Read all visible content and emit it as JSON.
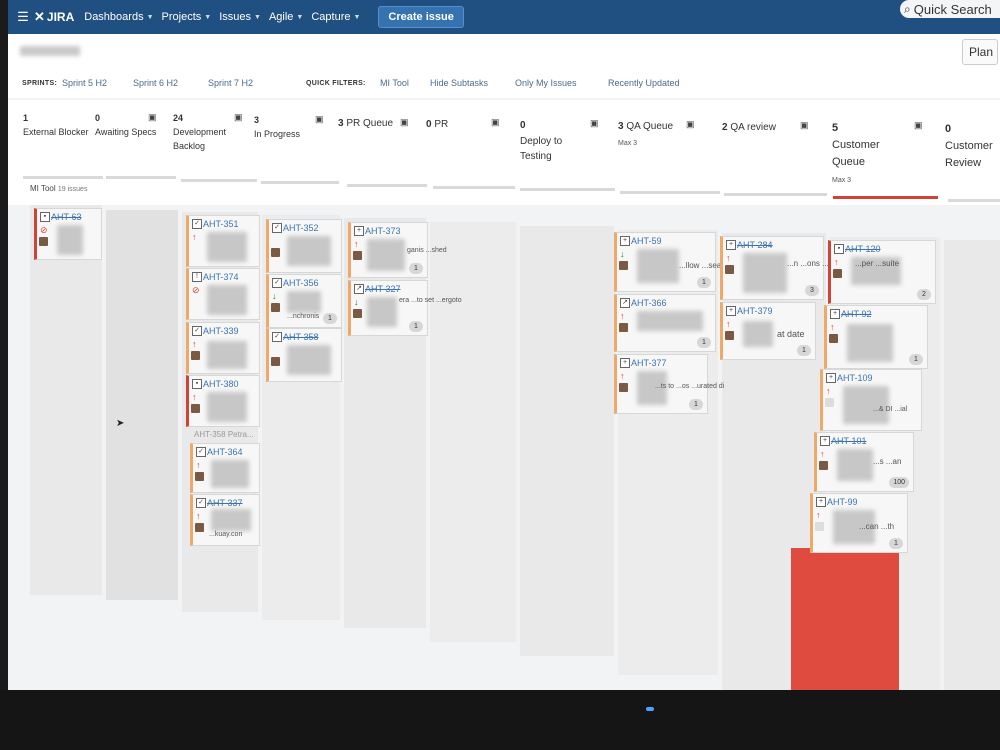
{
  "nav": {
    "menu_glyph": "☰",
    "logo_text": "JIRA",
    "items": [
      "Dashboards",
      "Projects",
      "Issues",
      "Agile",
      "Capture"
    ],
    "create_label": "Create issue",
    "search_placeholder": "Quick Search"
  },
  "subheader": {
    "plan_label": "Plan"
  },
  "filterbar": {
    "sprints_label": "SPRINTS:",
    "sprints": [
      "Sprint 5 H2",
      "Sprint 6 H2",
      "Sprint 7 H2"
    ],
    "quick_filters_label": "QUICK FILTERS:",
    "quick_filters": [
      "MI Tool",
      "Hide Subtasks",
      "Only My Issues",
      "Recently Updated"
    ]
  },
  "columns": [
    {
      "count": "1",
      "name": "External Blocker"
    },
    {
      "count": "0",
      "name": "Awaiting Specs"
    },
    {
      "count": "24",
      "name": "Development Backlog"
    },
    {
      "count": "3",
      "name": "In Progress"
    },
    {
      "count": "3",
      "name": "PR Queue"
    },
    {
      "count": "0",
      "name": "PR"
    },
    {
      "count": "0",
      "name": "Deploy to Testing"
    },
    {
      "count": "3",
      "name": "QA Queue",
      "max": "Max 3"
    },
    {
      "count": "2",
      "name": "QA review"
    },
    {
      "count": "5",
      "name": "Customer Queue",
      "max": "Max 3"
    },
    {
      "count": "0",
      "name": "Customer Review"
    }
  ],
  "swimlane": {
    "label": "MI Tool",
    "sub": "19 issues"
  },
  "cards": {
    "c1": {
      "key": "AHT-63"
    },
    "c2": {
      "key": "AHT-351"
    },
    "c3": {
      "key": "AHT-374"
    },
    "c4": {
      "key": "AHT-339"
    },
    "c5": {
      "key": "AHT-380"
    },
    "c6": {
      "key": "AHT-358",
      "text": "Petra..."
    },
    "c7": {
      "key": "AHT-364"
    },
    "c8": {
      "key": "AHT-337",
      "text": "...kuay.con"
    },
    "c9": {
      "key": "AHT-352"
    },
    "c10": {
      "key": "AHT-356",
      "text": "...nchronis",
      "badge": "1"
    },
    "c11": {
      "key": "AHT-358"
    },
    "c12": {
      "key": "AHT-373",
      "text": "ganis ...shed",
      "badge": "1"
    },
    "c13": {
      "key": "AHT-327",
      "text": "era ...to set ...ergoto",
      "badge": "1"
    },
    "c14": {
      "key": "AHT-59",
      "text": "...llow ...searches",
      "badge": "1"
    },
    "c15": {
      "key": "AHT-366",
      "badge": "1"
    },
    "c16": {
      "key": "AHT-377",
      "text": "...ts to ...os ...urated di",
      "badge": "1"
    },
    "c17": {
      "key": "AHT-284",
      "text": "...n ...ons ...ation",
      "badge": "3"
    },
    "c18": {
      "key": "AHT-379",
      "text": "at date",
      "badge": "1"
    },
    "c19": {
      "key": "AHT-120",
      "text": "...per ...suite",
      "badge": "2"
    },
    "c20": {
      "key": "AHT-92",
      "badge": "1"
    },
    "c21": {
      "key": "AHT-109",
      "text": "...& DI ...ial"
    },
    "c22": {
      "key": "AHT-101",
      "text": "...s ...an",
      "badge": "100"
    },
    "c23": {
      "key": "AHT-99",
      "text": "...can ...th",
      "badge": "1"
    }
  }
}
